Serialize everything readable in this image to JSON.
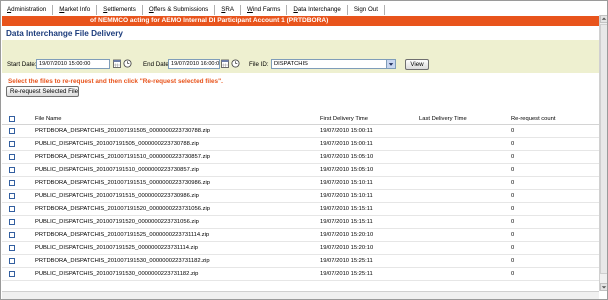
{
  "menu": [
    {
      "pre": "",
      "ul": "A",
      "post": "dministration",
      "name": "menu-administration"
    },
    {
      "pre": "",
      "ul": "M",
      "post": "arket Info",
      "name": "menu-market-info"
    },
    {
      "pre": "",
      "ul": "S",
      "post": "ettlements",
      "name": "menu-settlements"
    },
    {
      "pre": "",
      "ul": "O",
      "post": "ffers & Submissions",
      "name": "menu-offers-submissions"
    },
    {
      "pre": "",
      "ul": "S",
      "post": "RA",
      "name": "menu-sra"
    },
    {
      "pre": "",
      "ul": "W",
      "post": "ind Farms",
      "name": "menu-wind-farms"
    },
    {
      "pre": "",
      "ul": "D",
      "post": "ata Interchange",
      "name": "menu-data-interchange"
    },
    {
      "pre": "Sign Out",
      "ul": "",
      "post": "",
      "name": "menu-sign-out"
    }
  ],
  "banner": "of NEMMCO acting for AEMO Internal DI Participant Account 1 (PRTDBORA)",
  "page_title": "Data Interchange File Delivery",
  "filters": {
    "start_label": "Start Date:",
    "start_value": "19/07/2010 15:00:00",
    "end_label": "End Date:",
    "end_value": "19/07/2010 16:00:00",
    "file_id_label": "File ID:",
    "file_id_value": "DISPATCHIS",
    "view_button": "View"
  },
  "instruction": "Select the files to re-request and then click \"Re-request selected files\".",
  "rerequest_button": "Re-request Selected File",
  "table": {
    "headers": [
      "File Name",
      "First Delivery Time",
      "Last Delivery Time",
      "Re-request count"
    ],
    "rows": [
      {
        "file": "PRTDBORA_DISPATCHIS_201007191505_0000000223730788.zip",
        "first": "19/07/2010 15:00:11",
        "last": "",
        "count": "0"
      },
      {
        "file": "PUBLIC_DISPATCHIS_201007191505_0000000223730788.zip",
        "first": "19/07/2010 15:00:11",
        "last": "",
        "count": "0"
      },
      {
        "file": "PRTDBORA_DISPATCHIS_201007191510_0000000223730857.zip",
        "first": "19/07/2010 15:05:10",
        "last": "",
        "count": "0"
      },
      {
        "file": "PUBLIC_DISPATCHIS_201007191510_0000000223730857.zip",
        "first": "19/07/2010 15:05:10",
        "last": "",
        "count": "0"
      },
      {
        "file": "PRTDBORA_DISPATCHIS_201007191515_0000000223730986.zip",
        "first": "19/07/2010 15:10:11",
        "last": "",
        "count": "0"
      },
      {
        "file": "PUBLIC_DISPATCHIS_201007191515_0000000223730986.zip",
        "first": "19/07/2010 15:10:11",
        "last": "",
        "count": "0"
      },
      {
        "file": "PRTDBORA_DISPATCHIS_201007191520_0000000223731056.zip",
        "first": "19/07/2010 15:15:11",
        "last": "",
        "count": "0"
      },
      {
        "file": "PUBLIC_DISPATCHIS_201007191520_0000000223731056.zip",
        "first": "19/07/2010 15:15:11",
        "last": "",
        "count": "0"
      },
      {
        "file": "PRTDBORA_DISPATCHIS_201007191525_0000000223731114.zip",
        "first": "19/07/2010 15:20:10",
        "last": "",
        "count": "0"
      },
      {
        "file": "PUBLIC_DISPATCHIS_201007191525_0000000223731114.zip",
        "first": "19/07/2010 15:20:10",
        "last": "",
        "count": "0"
      },
      {
        "file": "PRTDBORA_DISPATCHIS_201007191530_0000000223731182.zip",
        "first": "19/07/2010 15:25:11",
        "last": "",
        "count": "0"
      },
      {
        "file": "PUBLIC_DISPATCHIS_201007191530_0000000223731182.zip",
        "first": "19/07/2010 15:25:11",
        "last": "",
        "count": "0"
      }
    ]
  },
  "colors": {
    "banner": "#e8541c",
    "title": "#1c3c7c",
    "filter_panel": "#eef0d0",
    "instruction": "#e8541c"
  }
}
